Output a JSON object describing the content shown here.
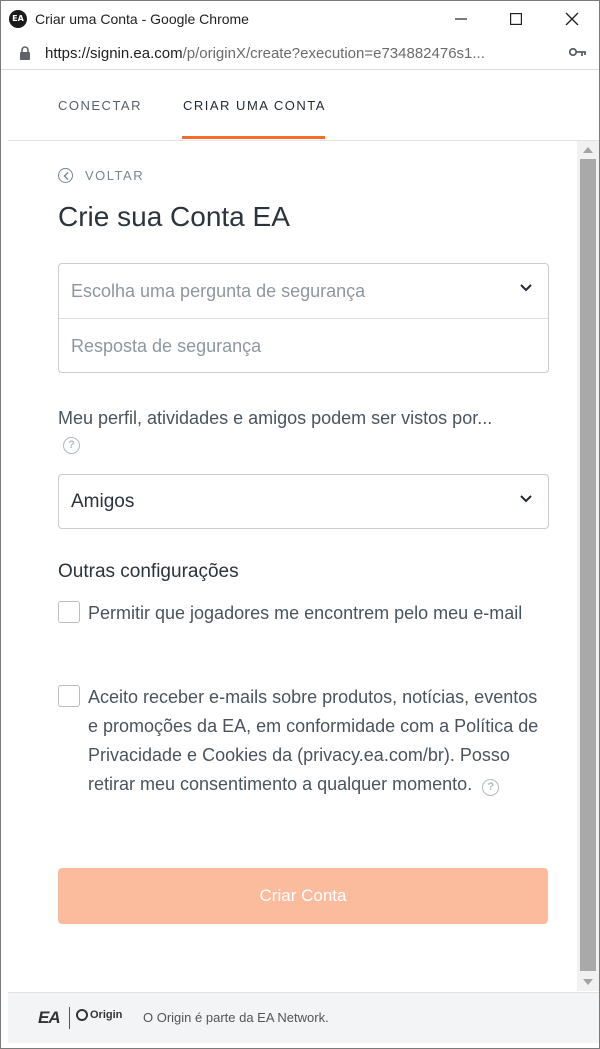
{
  "window": {
    "title": "Criar uma Conta - Google Chrome",
    "app_icon_label": "EA"
  },
  "address_bar": {
    "url_main": "https://signin.ea.com",
    "url_path": "/p/originX/create?execution=e734882476s1..."
  },
  "tabs": [
    {
      "label": "CONECTAR",
      "active": false
    },
    {
      "label": "CRIAR UMA CONTA",
      "active": true
    }
  ],
  "form": {
    "back_label": "VOLTAR",
    "heading": "Crie sua Conta EA",
    "security_question_placeholder": "Escolha uma pergunta de segurança",
    "security_answer_placeholder": "Resposta de segurança",
    "visibility_label": "Meu perfil, atividades e amigos podem ser vistos por...",
    "visibility_value": "Amigos",
    "other_settings": "Outras configurações",
    "checkbox_find_by_email": "Permitir que jogadores me encontrem pelo meu e-mail",
    "checkbox_marketing": "Aceito receber e-mails sobre produtos, notícias, eventos e promoções da EA, em conformidade com a Política de Privacidade e Cookies da (privacy.ea.com/br). Posso retirar meu consentimento a qualquer momento.",
    "submit_label": "Criar Conta",
    "help_glyph": "?"
  },
  "footer": {
    "ea_logo": "EA",
    "origin_logo": "Origin",
    "text": "O Origin é parte da EA Network."
  },
  "colors": {
    "accent": "#f56c2d",
    "button_disabled": "#fbbc9e"
  }
}
